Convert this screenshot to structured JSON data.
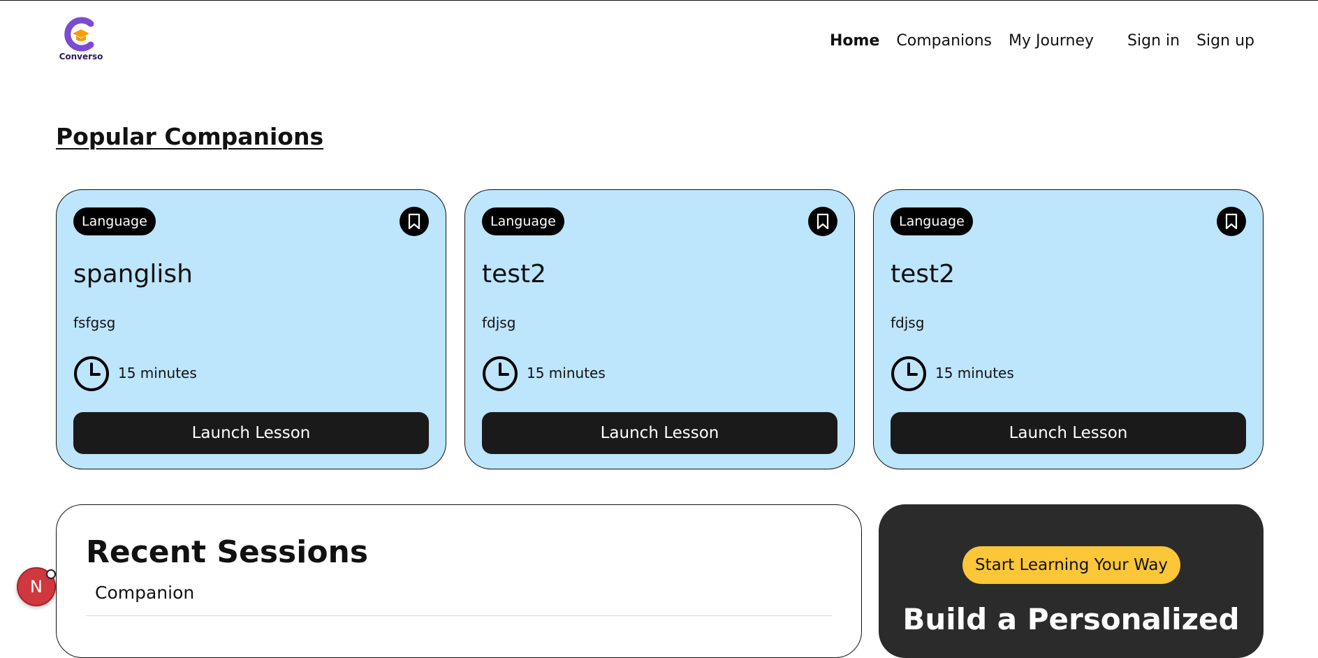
{
  "brand": {
    "logo_text": "Converso"
  },
  "nav": {
    "items": [
      "Home",
      "Companions",
      "My Journey"
    ],
    "sign_in": "Sign in",
    "sign_up": "Sign up"
  },
  "popular": {
    "title": "Popular Companions",
    "cards": [
      {
        "subject": "Language",
        "name": "spanglish",
        "topic": "fsfgsg",
        "duration": "15 minutes",
        "button": "Launch Lesson"
      },
      {
        "subject": "Language",
        "name": "test2",
        "topic": "fdjsg",
        "duration": "15 minutes",
        "button": "Launch Lesson"
      },
      {
        "subject": "Language",
        "name": "test2",
        "topic": "fdjsg",
        "duration": "15 minutes",
        "button": "Launch Lesson"
      }
    ]
  },
  "recent": {
    "title": "Recent Sessions",
    "columns": [
      "Companion"
    ]
  },
  "cta": {
    "badge": "Start Learning Your Way",
    "heading": "Build a Personalized"
  },
  "dev_indicator": {
    "label": "N"
  },
  "colors": {
    "card_bg": "#bde5fc",
    "cta_bg": "#2b2b2b",
    "cta_badge": "#fbc638",
    "brand_purple": "#7b4bd1",
    "brand_orange": "#f59e0b"
  }
}
